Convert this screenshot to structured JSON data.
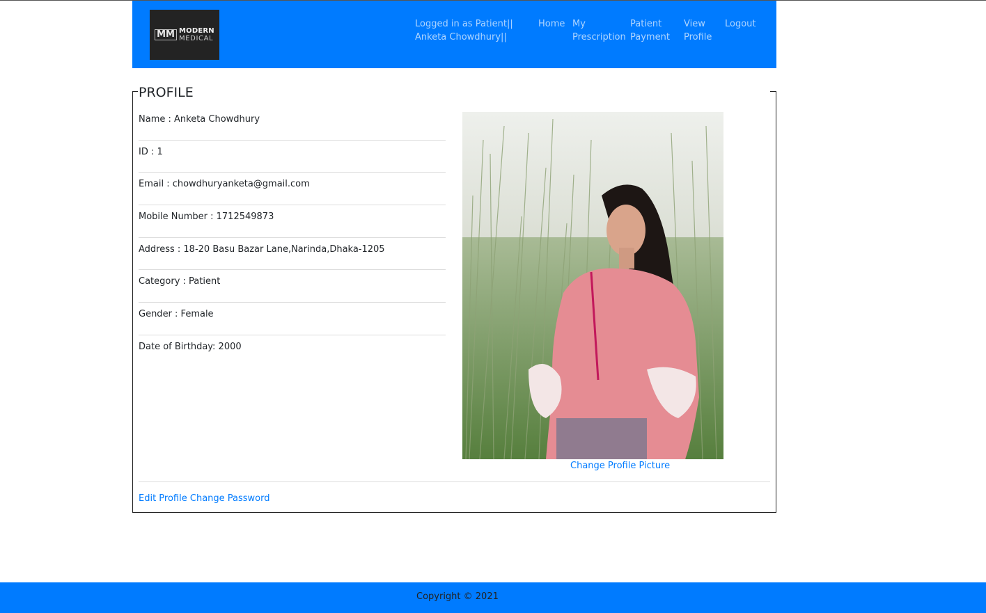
{
  "header": {
    "logo": {
      "mark": "MM",
      "line1": "MODERN",
      "line2": "MEDICAL"
    },
    "status_line1": "Logged in as Patient||",
    "status_line2": "Anketa Chowdhury||",
    "nav": {
      "home": "Home",
      "prescription": "My Prescription",
      "payment": "Patient Payment",
      "view_profile": "View Profile",
      "logout": "Logout"
    }
  },
  "profile": {
    "legend": "PROFILE",
    "fields": [
      "Name : Anketa Chowdhury",
      "ID : 1",
      "Email : chowdhuryanketa@gmail.com",
      "Mobile Number : 1712549873",
      "Address : 18-20 Basu Bazar Lane,Narinda,Dhaka-1205",
      "Category : Patient",
      "Gender : Female",
      "Date of Birthday: 2000"
    ],
    "change_picture": "Change Profile Picture",
    "edit_profile": "Edit Profile",
    "change_password": "Change Password"
  },
  "footer": {
    "copyright": "Copyright © 2021"
  },
  "colors": {
    "brand": "#007bff",
    "link": "#007bff",
    "nav_text": "rgba(255,255,255,0.68)"
  }
}
